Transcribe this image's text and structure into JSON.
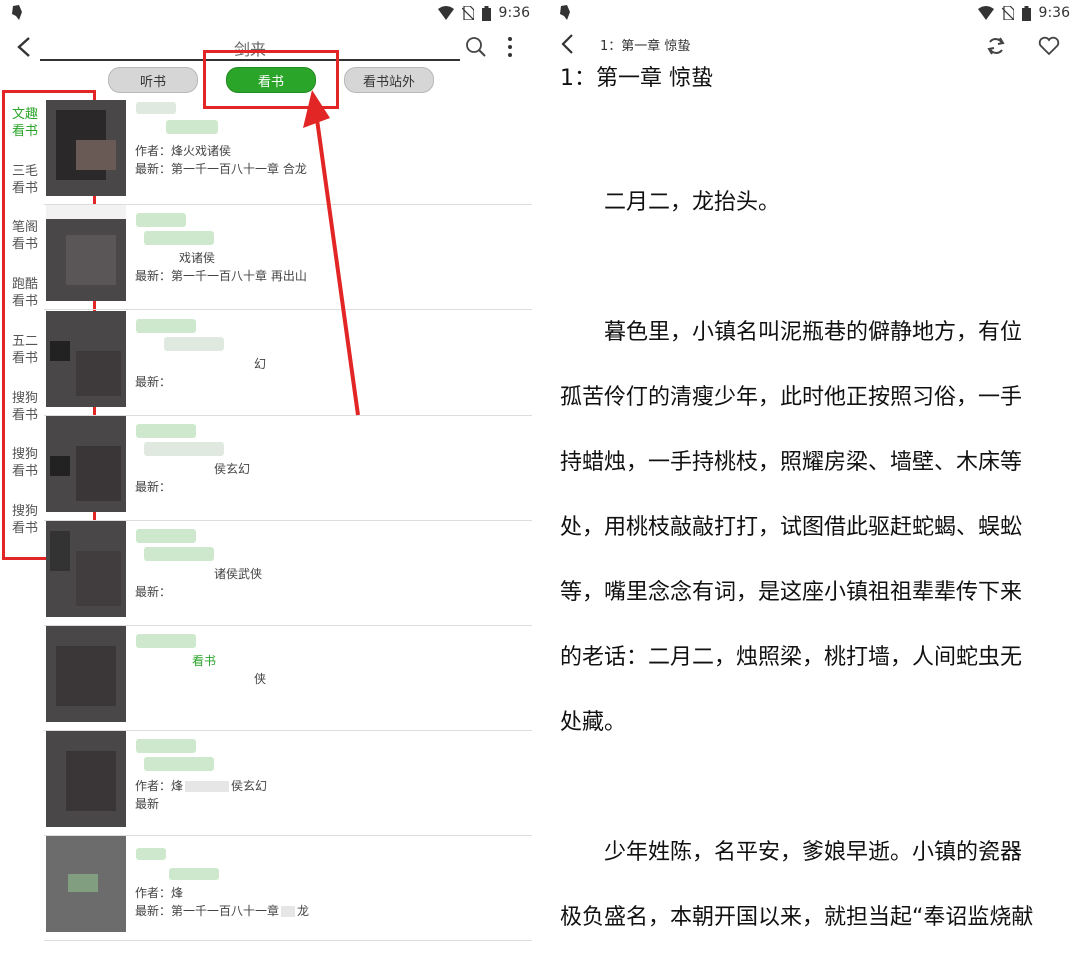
{
  "status": {
    "time": "9:36"
  },
  "search": {
    "query": "剑来",
    "tabs": [
      "听书",
      "看书",
      "看书站外"
    ]
  },
  "sources": [
    {
      "line1": "文趣",
      "line2": "看书"
    },
    {
      "line1": "三毛",
      "line2": "看书"
    },
    {
      "line1": "笔阁",
      "line2": "看书"
    },
    {
      "line1": "跑酷",
      "line2": "看书"
    },
    {
      "line1": "五二",
      "line2": "看书"
    },
    {
      "line1": "搜狗",
      "line2": "看书"
    },
    {
      "line1": "搜狗",
      "line2": "看书"
    },
    {
      "line1": "搜狗",
      "line2": "看书"
    }
  ],
  "results": [
    {
      "author": "作者：烽火戏诸侯",
      "latest": "最新：第一千一百八十一章 合龙"
    },
    {
      "author": "戏诸侯",
      "latest": "最新：第一千一百八十章 再出山"
    },
    {
      "author": "幻",
      "latest": "最新："
    },
    {
      "author": "侯玄幻",
      "latest": "最新："
    },
    {
      "author": "诸侯武侠",
      "latest": "最新："
    },
    {
      "author": "侠",
      "source": "看书",
      "latest": ""
    },
    {
      "author": "作者：烽",
      "author_tail": "侯玄幻",
      "latest": "最新"
    },
    {
      "author": "作者：烽",
      "latest": "最新：第一千一百八十一章",
      "latest_tail": "龙"
    }
  ],
  "reader": {
    "header_title": "1：第一章 惊蛰",
    "chapter_title": "1：第一章 惊蛰",
    "lines": [
      "　　二月二，龙抬头。",
      "　　暮色里，小镇名叫泥瓶巷的僻静地方，有位",
      "孤苦伶仃的清瘦少年，此时他正按照习俗，一手",
      "持蜡烛，一手持桃枝，照耀房梁、墙壁、木床等",
      "处，用桃枝敲敲打打，试图借此驱赶蛇蝎、蜈蚣",
      "等，嘴里念念有词，是这座小镇祖祖辈辈传下来",
      "的老话：二月二，烛照梁，桃打墙，人间蛇虫无",
      "处藏。",
      "　　少年姓陈，名平安，爹娘早逝。小镇的瓷器",
      "极负盛名，本朝开国以来，就担当起“奉诏监烧献"
    ]
  },
  "colors": {
    "accent_green": "#2aa52a",
    "highlight_red": "#e22626"
  }
}
